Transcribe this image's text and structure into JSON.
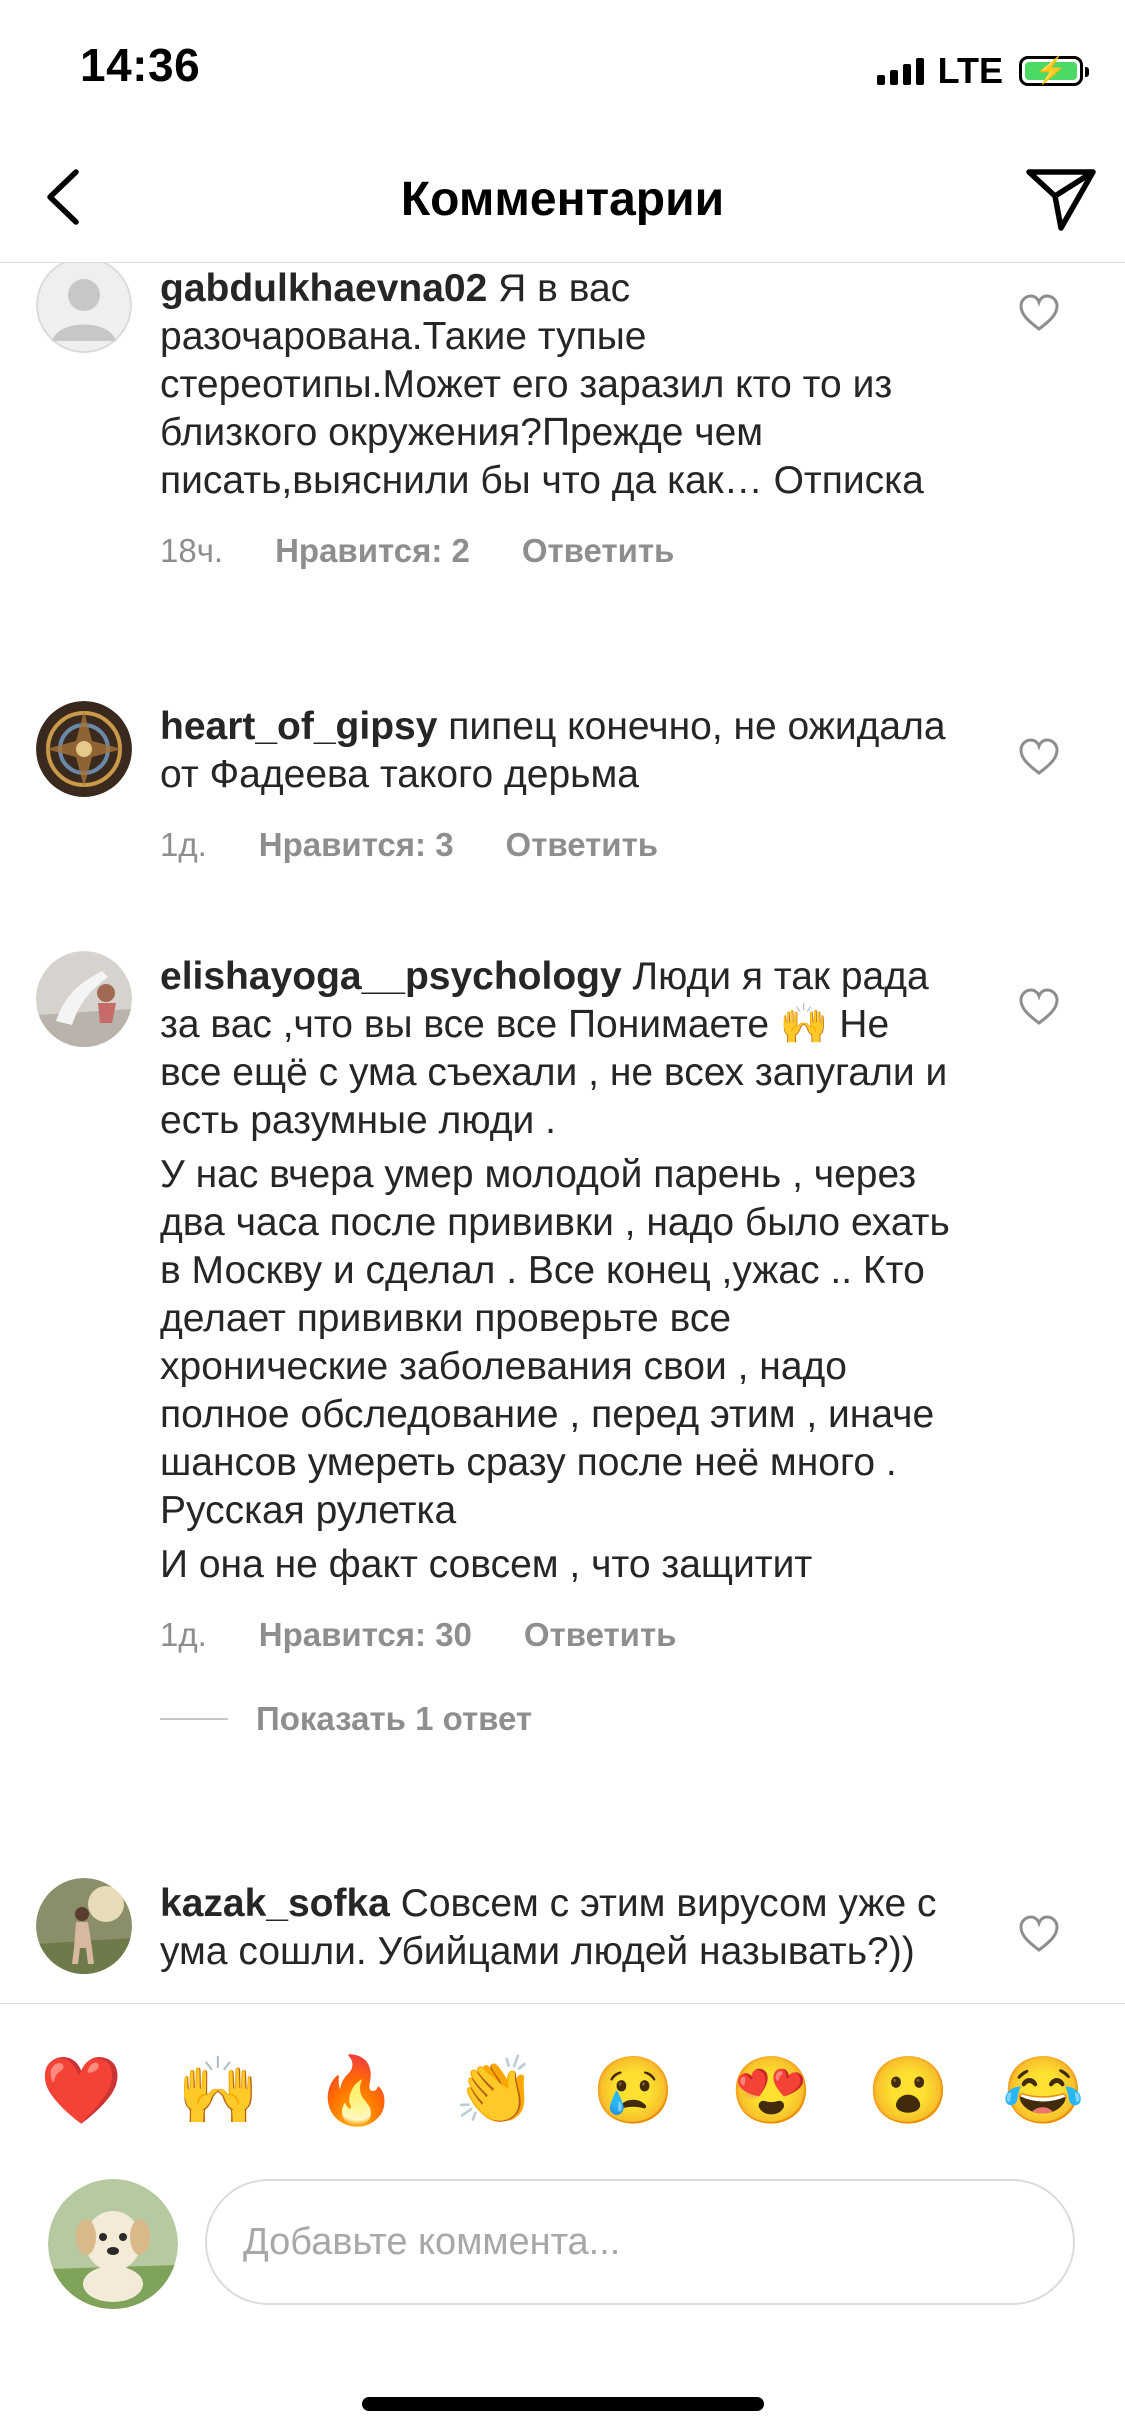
{
  "status_bar": {
    "time": "14:36",
    "network": "LTE",
    "battery_color": "#4cd964"
  },
  "header": {
    "title": "Комментарии",
    "back_icon": "chevron-left-icon",
    "send_icon": "paper-plane-icon"
  },
  "comments": [
    {
      "username": "gabdulkhaevna02",
      "text": "Я в вас разочарована.Такие тупые стереотипы.Может его заразил кто то из близкого окружения?Прежде чем писать,выяснили бы что да как… Отписка",
      "time": "18ч.",
      "likes": "Нравится: 2",
      "reply": "Ответить"
    },
    {
      "username": "heart_of_gipsy",
      "text": "пипец конечно, не ожидала от Фадеева такого дерьма",
      "time": "1д.",
      "likes": "Нравится: 3",
      "reply": "Ответить"
    },
    {
      "username": "elishayoga__psychology",
      "text": "Люди я так рада за вас ,что вы все все Понимаете 🙌 Не все ещё с ума съехали , не всех запугали и есть разумные люди .",
      "text2": "У нас вчера умер молодой парень , через два часа после прививки , надо было ехать в Москву и сделал . Все конец ,ужас .. Кто делает прививки проверьте все хронические заболевания свои , надо полное обследование , перед этим , иначе шансов умереть сразу после неё много . Русская рулетка",
      "text3": "И она не факт совсем , что защитит",
      "time": "1д.",
      "likes": "Нравится: 30",
      "reply": "Ответить",
      "view_replies": "Показать 1 ответ"
    },
    {
      "username": "kazak_sofka",
      "text": "Совсем с этим вирусом уже с ума сошли. Убийцами людей называть?))"
    }
  ],
  "emoji_bar": [
    "❤️",
    "🙌",
    "🔥",
    "👏",
    "😢",
    "😍",
    "😮",
    "😂"
  ],
  "input": {
    "placeholder": "Добавьте коммента..."
  }
}
